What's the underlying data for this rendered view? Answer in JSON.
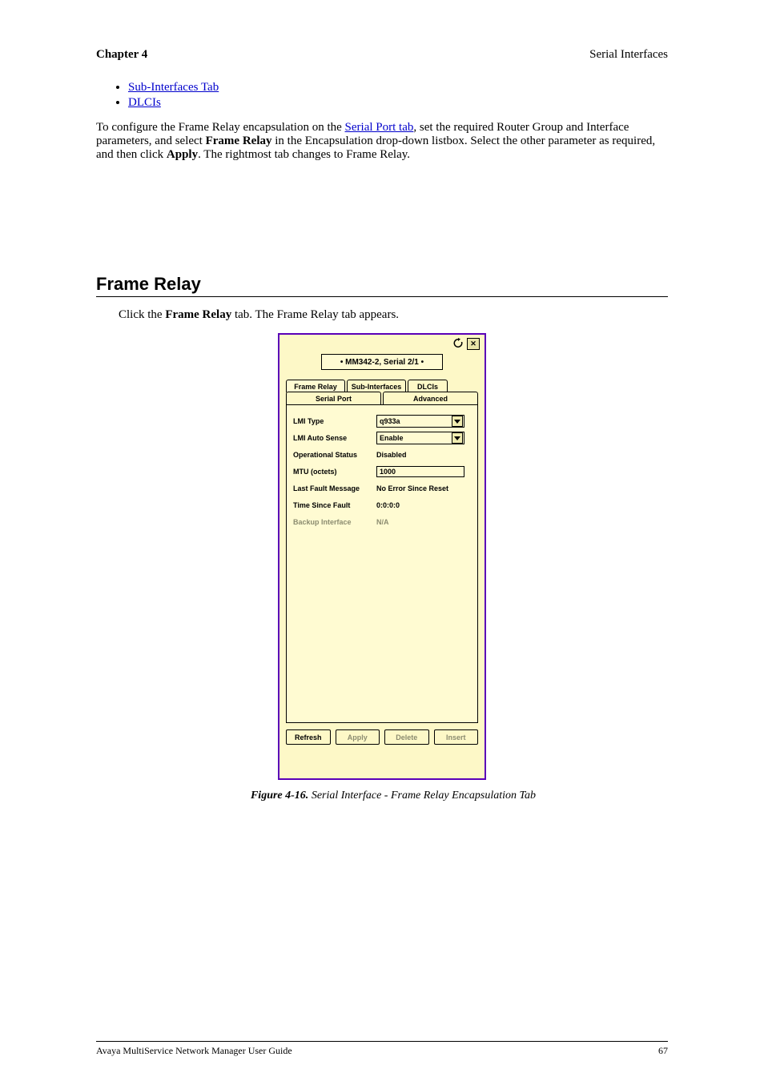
{
  "header": {
    "chapter": "Chapter 4",
    "section": "Serial Interfaces"
  },
  "bullets": [
    {
      "label": "Sub-Interfaces Tab"
    },
    {
      "label": "DLCIs"
    }
  ],
  "para1_a": "To configure the Frame Relay encapsulation on the ",
  "para1_link": "Serial Port tab",
  "para1_b": ", set the required Router Group and Interface parameters, and select ",
  "para1_bold": "Frame Relay",
  "para1_c": " in the Encapsulation drop-down listbox. Select the other parameter as required, and then click ",
  "para1_apply": "Apply",
  "para1_end": ". The rightmost tab changes to Frame Relay.",
  "section_heading": "Frame Relay",
  "para2_a": "Click the ",
  "para2_b": "Frame Relay",
  "para2_c": " tab. The Frame Relay tab appears.",
  "fig_caption_a": "Figure 4-16.",
  "fig_caption_b": "Serial Interface - Frame Relay Encapsulation Tab",
  "dialog": {
    "title": "• MM342-2, Serial 2/1 •",
    "tabs_top": [
      "Frame Relay",
      "Sub-Interfaces",
      "DLCIs"
    ],
    "tabs_bottom": [
      "Serial Port",
      "Advanced"
    ],
    "fields": {
      "lmi_type": {
        "label": "LMI Type",
        "value": "q933a"
      },
      "lmi_auto_sense": {
        "label": "LMI Auto Sense",
        "value": "Enable"
      },
      "op_status": {
        "label": "Operational Status",
        "value": "Disabled"
      },
      "mtu": {
        "label": "MTU (octets)",
        "value": "1000"
      },
      "last_fault": {
        "label": "Last Fault Message",
        "value": "No Error Since Reset"
      },
      "time_since": {
        "label": "Time Since Fault",
        "value": "0:0:0:0"
      },
      "backup": {
        "label": "Backup Interface",
        "value": "N/A"
      }
    },
    "buttons": {
      "refresh": "Refresh",
      "apply": "Apply",
      "delete": "Delete",
      "insert": "Insert"
    }
  },
  "footer": {
    "left": "Avaya MultiService Network Manager User Guide",
    "right": "67"
  }
}
